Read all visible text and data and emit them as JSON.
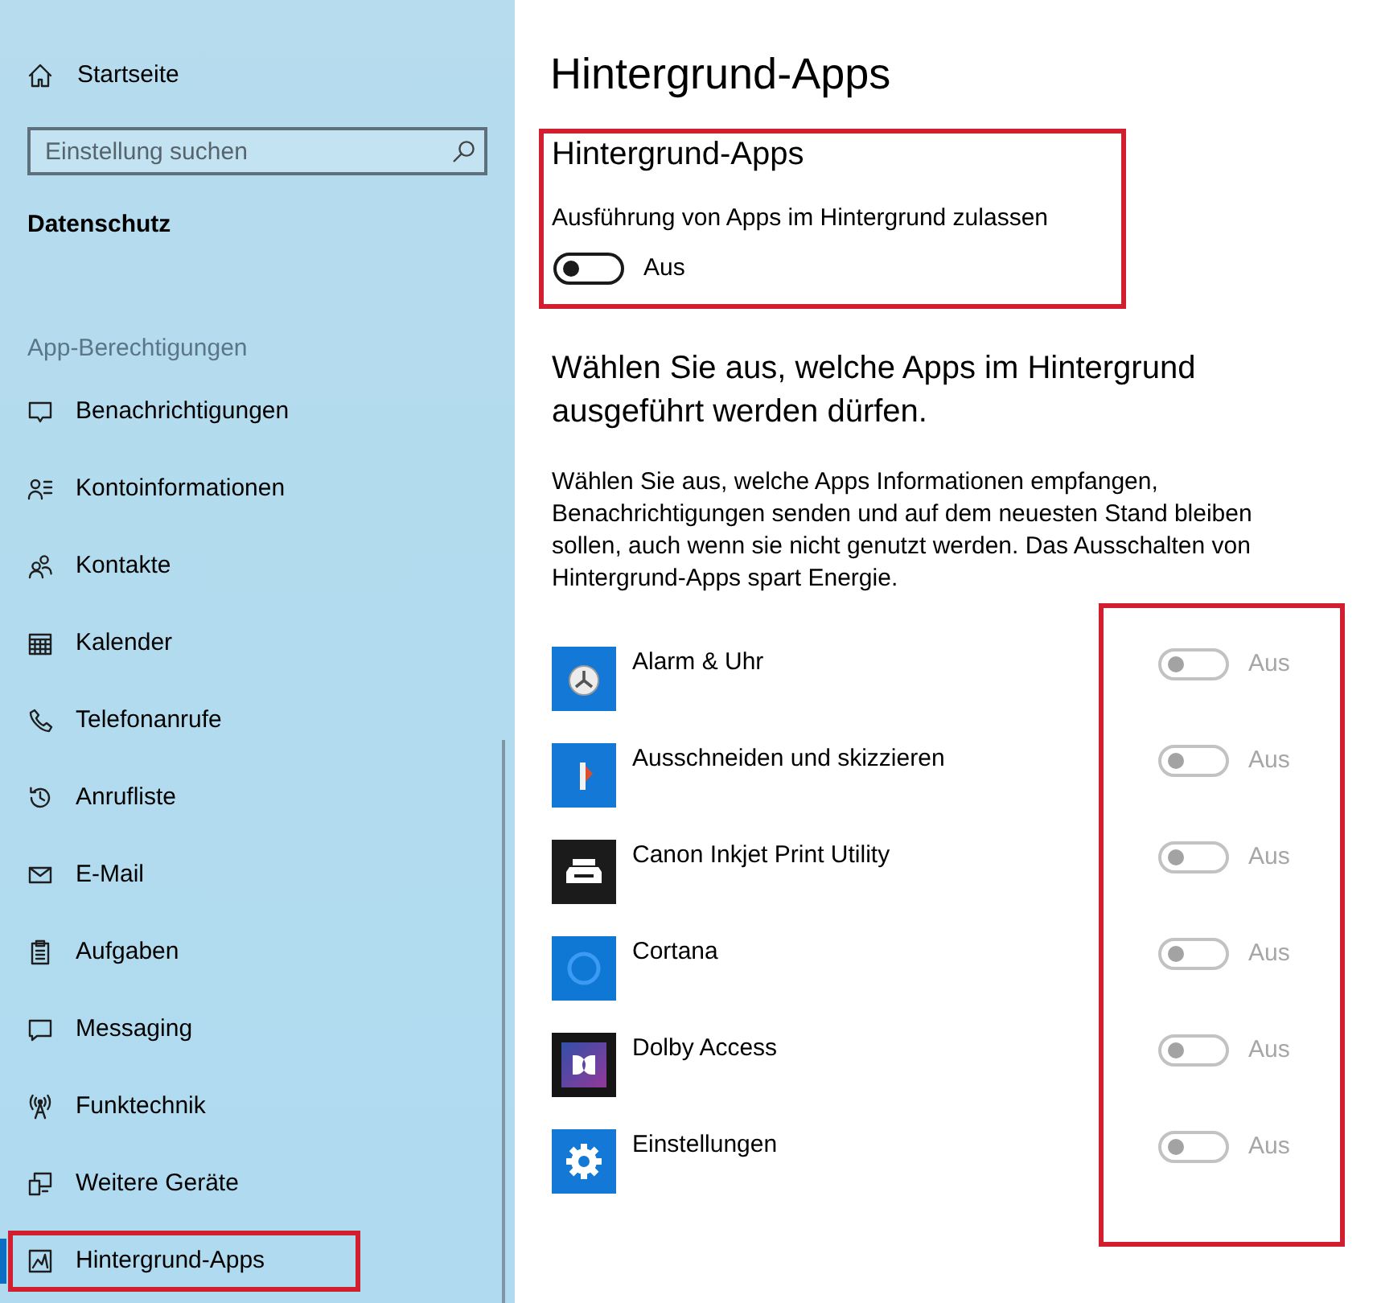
{
  "sidebar": {
    "home": {
      "label": "Startseite"
    },
    "search": {
      "placeholder": "Einstellung suchen"
    },
    "section_title": "Datenschutz",
    "group_title": "App-Berechtigungen",
    "items": [
      {
        "label": "Benachrichtigungen",
        "selected": false,
        "highlighted": false
      },
      {
        "label": "Kontoinformationen",
        "selected": false,
        "highlighted": false
      },
      {
        "label": "Kontakte",
        "selected": false,
        "highlighted": false
      },
      {
        "label": "Kalender",
        "selected": false,
        "highlighted": false
      },
      {
        "label": "Telefonanrufe",
        "selected": false,
        "highlighted": false
      },
      {
        "label": "Anrufliste",
        "selected": false,
        "highlighted": false
      },
      {
        "label": "E-Mail",
        "selected": false,
        "highlighted": false
      },
      {
        "label": "Aufgaben",
        "selected": false,
        "highlighted": false
      },
      {
        "label": "Messaging",
        "selected": false,
        "highlighted": false
      },
      {
        "label": "Funktechnik",
        "selected": false,
        "highlighted": false
      },
      {
        "label": "Weitere Geräte",
        "selected": false,
        "highlighted": false
      },
      {
        "label": "Hintergrund-Apps",
        "selected": true,
        "highlighted": true
      }
    ]
  },
  "page": {
    "title": "Hintergrund-Apps",
    "master": {
      "heading": "Hintergrund-Apps",
      "label": "Ausführung von Apps im Hintergrund zulassen",
      "on": false,
      "state_label": "Aus",
      "highlighted": true
    },
    "apps_heading": "Wählen Sie aus, welche Apps im Hintergrund ausgeführt werden dürfen.",
    "description": "Wählen Sie aus, welche Apps Informationen empfangen, Benachrichtigungen senden und auf dem neuesten Stand bleiben sollen, auch wenn sie nicht genutzt werden. Das Ausschalten von Hintergrund-Apps spart Energie.",
    "toggle_column_highlighted": true,
    "apps": [
      {
        "name": "Alarm & Uhr",
        "on": false,
        "disabled": true,
        "state_label": "Aus"
      },
      {
        "name": "Ausschneiden und skizzieren",
        "on": false,
        "disabled": true,
        "state_label": "Aus"
      },
      {
        "name": "Canon Inkjet Print Utility",
        "on": false,
        "disabled": true,
        "state_label": "Aus"
      },
      {
        "name": "Cortana",
        "on": false,
        "disabled": true,
        "state_label": "Aus"
      },
      {
        "name": "Dolby Access",
        "on": false,
        "disabled": true,
        "state_label": "Aus"
      },
      {
        "name": "Einstellungen",
        "on": false,
        "disabled": true,
        "state_label": "Aus"
      }
    ]
  }
}
